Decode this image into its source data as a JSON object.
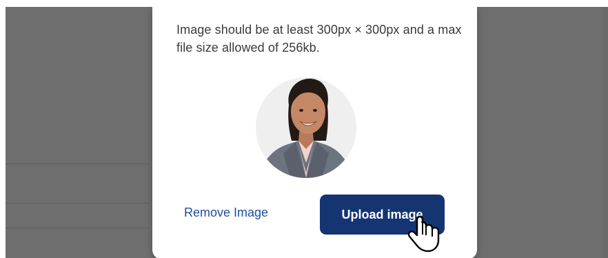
{
  "dialog": {
    "description": "Image should be at least 300px × 300px and a max file size allowed of 256kb.",
    "remove_label": "Remove Image",
    "upload_label": "Upload image"
  },
  "colors": {
    "overlay": "#6e6e6e",
    "modal_bg": "#ffffff",
    "link": "#1d4f99",
    "primary_button": "#143572",
    "text": "#3a3a3a"
  },
  "icons": {
    "cursor": "hand-pointer-icon"
  }
}
